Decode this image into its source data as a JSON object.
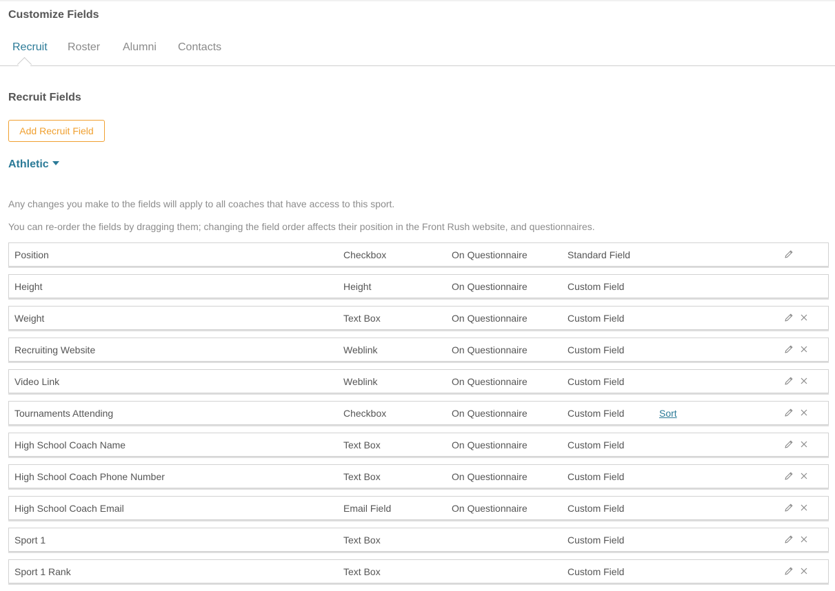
{
  "page": {
    "title": "Customize Fields"
  },
  "tabs": [
    {
      "label": "Recruit",
      "active": true
    },
    {
      "label": "Roster",
      "active": false
    },
    {
      "label": "Alumni",
      "active": false
    },
    {
      "label": "Contacts",
      "active": false
    }
  ],
  "section": {
    "title": "Recruit Fields",
    "add_button_label": "Add Recruit Field",
    "category_label": "Athletic"
  },
  "info": {
    "line1": "Any changes you make to the fields will apply to all coaches that have access to this sport.",
    "line2": "You can re-order the fields by dragging them; changing the field order affects their position in the Front Rush website, and questionnaires."
  },
  "colors": {
    "accent": "#2b7a97",
    "button_orange": "#f0a030",
    "text": "#555555",
    "muted_text": "#8c8c8c",
    "icon": "#8a8a8a"
  },
  "icons": {
    "edit": "pencil-icon",
    "delete": "close-icon",
    "category_toggle": "caret-down-icon"
  },
  "fields": [
    {
      "name": "Position",
      "type": "Checkbox",
      "questionnaire": "On Questionnaire",
      "kind": "Standard Field",
      "sort": "",
      "editable": true,
      "deletable": false
    },
    {
      "name": "Height",
      "type": "Height",
      "questionnaire": "On Questionnaire",
      "kind": "Custom Field",
      "sort": "",
      "editable": false,
      "deletable": false
    },
    {
      "name": "Weight",
      "type": "Text Box",
      "questionnaire": "On Questionnaire",
      "kind": "Custom Field",
      "sort": "",
      "editable": true,
      "deletable": true
    },
    {
      "name": "Recruiting Website",
      "type": "Weblink",
      "questionnaire": "On Questionnaire",
      "kind": "Custom Field",
      "sort": "",
      "editable": true,
      "deletable": true
    },
    {
      "name": "Video Link",
      "type": "Weblink",
      "questionnaire": "On Questionnaire",
      "kind": "Custom Field",
      "sort": "",
      "editable": true,
      "deletable": true
    },
    {
      "name": "Tournaments Attending",
      "type": "Checkbox",
      "questionnaire": "On Questionnaire",
      "kind": "Custom Field",
      "sort": "Sort",
      "editable": true,
      "deletable": true
    },
    {
      "name": "High School Coach Name",
      "type": "Text Box",
      "questionnaire": "On Questionnaire",
      "kind": "Custom Field",
      "sort": "",
      "editable": true,
      "deletable": true
    },
    {
      "name": "High School Coach Phone Number",
      "type": "Text Box",
      "questionnaire": "On Questionnaire",
      "kind": "Custom Field",
      "sort": "",
      "editable": true,
      "deletable": true
    },
    {
      "name": "High School Coach Email",
      "type": "Email Field",
      "questionnaire": "On Questionnaire",
      "kind": "Custom Field",
      "sort": "",
      "editable": true,
      "deletable": true
    },
    {
      "name": "Sport 1",
      "type": "Text Box",
      "questionnaire": "",
      "kind": "Custom Field",
      "sort": "",
      "editable": true,
      "deletable": true
    },
    {
      "name": "Sport 1 Rank",
      "type": "Text Box",
      "questionnaire": "",
      "kind": "Custom Field",
      "sort": "",
      "editable": true,
      "deletable": true
    }
  ]
}
